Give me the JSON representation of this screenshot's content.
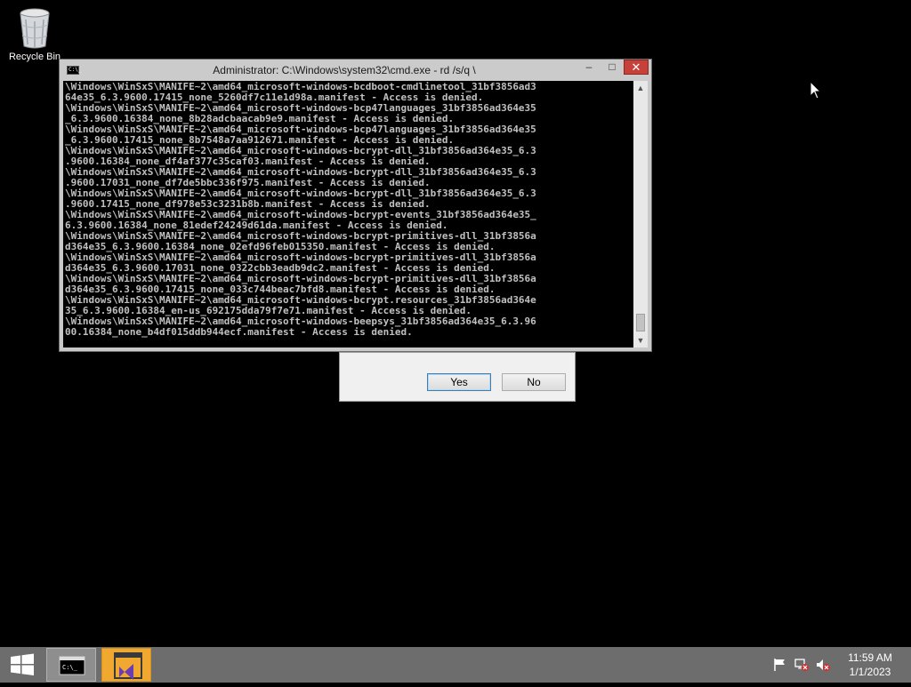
{
  "desktop": {
    "recycle_bin_label": "Recycle Bin"
  },
  "cmd_window": {
    "title": "Administrator: C:\\Windows\\system32\\cmd.exe - rd /s/q \\",
    "app_icon_text": "C:\\_",
    "minimize_glyph": "–",
    "maximize_glyph": "□",
    "close_glyph": "✕",
    "console_text": "\\Windows\\WinSxS\\MANIFE~2\\amd64_microsoft-windows-bcdboot-cmdlinetool_31bf3856ad3\n64e35_6.3.9600.17415_none_5260df7c11e1d98a.manifest - Access is denied.\n\\Windows\\WinSxS\\MANIFE~2\\amd64_microsoft-windows-bcp47languages_31bf3856ad364e35\n_6.3.9600.16384_none_8b28adcbaacab9e9.manifest - Access is denied.\n\\Windows\\WinSxS\\MANIFE~2\\amd64_microsoft-windows-bcp47languages_31bf3856ad364e35\n_6.3.9600.17415_none_8b7548a7aa912671.manifest - Access is denied.\n\\Windows\\WinSxS\\MANIFE~2\\amd64_microsoft-windows-bcrypt-dll_31bf3856ad364e35_6.3\n.9600.16384_none_df4af377c35caf03.manifest - Access is denied.\n\\Windows\\WinSxS\\MANIFE~2\\amd64_microsoft-windows-bcrypt-dll_31bf3856ad364e35_6.3\n.9600.17031_none_df7de5bbc336f975.manifest - Access is denied.\n\\Windows\\WinSxS\\MANIFE~2\\amd64_microsoft-windows-bcrypt-dll_31bf3856ad364e35_6.3\n.9600.17415_none_df978e53c3231b8b.manifest - Access is denied.\n\\Windows\\WinSxS\\MANIFE~2\\amd64_microsoft-windows-bcrypt-events_31bf3856ad364e35_\n6.3.9600.16384_none_81edef24249d61da.manifest - Access is denied.\n\\Windows\\WinSxS\\MANIFE~2\\amd64_microsoft-windows-bcrypt-primitives-dll_31bf3856a\nd364e35_6.3.9600.16384_none_02efd96feb015350.manifest - Access is denied.\n\\Windows\\WinSxS\\MANIFE~2\\amd64_microsoft-windows-bcrypt-primitives-dll_31bf3856a\nd364e35_6.3.9600.17031_none_0322cbb3eadb9dc2.manifest - Access is denied.\n\\Windows\\WinSxS\\MANIFE~2\\amd64_microsoft-windows-bcrypt-primitives-dll_31bf3856a\nd364e35_6.3.9600.17415_none_033c744beac7bfd8.manifest - Access is denied.\n\\Windows\\WinSxS\\MANIFE~2\\amd64_microsoft-windows-bcrypt.resources_31bf3856ad364e\n35_6.3.9600.16384_en-us_692175dda79f7e71.manifest - Access is denied.\n\\Windows\\WinSxS\\MANIFE~2\\amd64_microsoft-windows-beepsys_31bf3856ad364e35_6.3.96\n00.16384_none_b4df015ddb944ecf.manifest - Access is denied."
  },
  "dialog": {
    "yes_label": "Yes",
    "no_label": "No"
  },
  "taskbar": {
    "time": "11:59 AM",
    "date": "1/1/2023",
    "colors": {
      "taskbar_bg": "#6d6d6d",
      "vs_item_bg": "#f0a830",
      "close_button": "#c7403a"
    },
    "icons": [
      "windows-logo-icon",
      "cmd-icon",
      "visual-studio-icon",
      "flag-icon",
      "network-disconnected-icon",
      "speaker-muted-icon"
    ]
  }
}
